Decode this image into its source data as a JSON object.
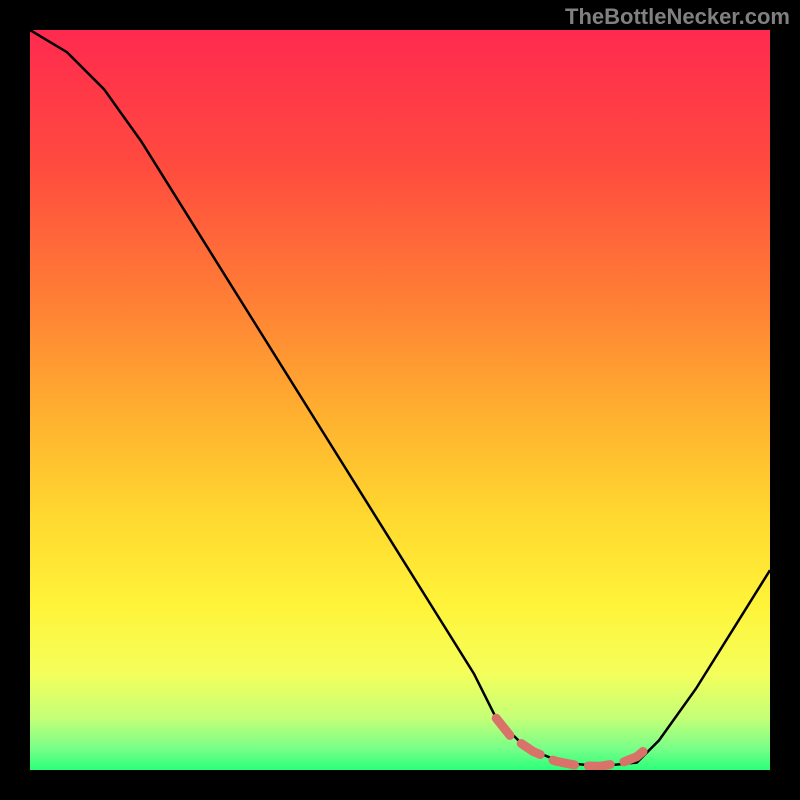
{
  "attribution": "TheBottleNecker.com",
  "chart_data": {
    "type": "line",
    "title": "",
    "xlabel": "",
    "ylabel": "",
    "x_range": [
      0,
      100
    ],
    "y_range": [
      0,
      100
    ],
    "series": [
      {
        "name": "bottleneck-curve",
        "x": [
          0,
          5,
          10,
          15,
          20,
          25,
          30,
          35,
          40,
          45,
          50,
          55,
          60,
          63,
          67,
          72,
          77,
          82,
          85,
          90,
          95,
          100
        ],
        "y": [
          100,
          97,
          92,
          85,
          77,
          69,
          61,
          53,
          45,
          37,
          29,
          21,
          13,
          7,
          3,
          1,
          0.5,
          1,
          4,
          11,
          19,
          27
        ],
        "color": "#000000"
      },
      {
        "name": "highlighted-trough",
        "x": [
          63,
          65,
          68,
          71,
          74,
          77,
          80,
          82,
          84
        ],
        "y": [
          7,
          4.5,
          2.5,
          1.2,
          0.6,
          0.5,
          1,
          1.8,
          3.5
        ],
        "color": "#d9736a",
        "style": "dashed-thick"
      }
    ],
    "gradient_stops": [
      {
        "offset": 0,
        "color": "#ff2a4f"
      },
      {
        "offset": 18,
        "color": "#ff4a3f"
      },
      {
        "offset": 35,
        "color": "#ff7a36"
      },
      {
        "offset": 52,
        "color": "#ffb02f"
      },
      {
        "offset": 66,
        "color": "#ffd92f"
      },
      {
        "offset": 78,
        "color": "#fff43a"
      },
      {
        "offset": 87,
        "color": "#f4ff5c"
      },
      {
        "offset": 93,
        "color": "#c4ff77"
      },
      {
        "offset": 97,
        "color": "#7aff88"
      },
      {
        "offset": 100,
        "color": "#2bff7a"
      }
    ]
  }
}
